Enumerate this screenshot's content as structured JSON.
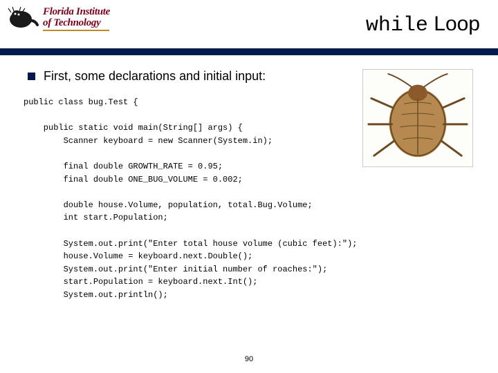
{
  "logo": {
    "line1": "Florida Institute",
    "line2": "of Technology"
  },
  "title": {
    "mono": "while",
    "rest": " Loop"
  },
  "bullet": "First, some declarations and initial input:",
  "code": "public class bug.Test {\n\n    public static void main(String[] args) {\n        Scanner keyboard = new Scanner(System.in);\n\n        final double GROWTH_RATE = 0.95;\n        final double ONE_BUG_VOLUME = 0.002;\n\n        double house.Volume, population, total.Bug.Volume;\n        int start.Population;\n\n        System.out.print(\"Enter total house volume (cubic feet):\");\n        house.Volume = keyboard.next.Double();\n        System.out.print(\"Enter initial number of roaches:\");\n        start.Population = keyboard.next.Int();\n        System.out.println();",
  "page_number": "90",
  "bug_alt": "cockroach illustration"
}
